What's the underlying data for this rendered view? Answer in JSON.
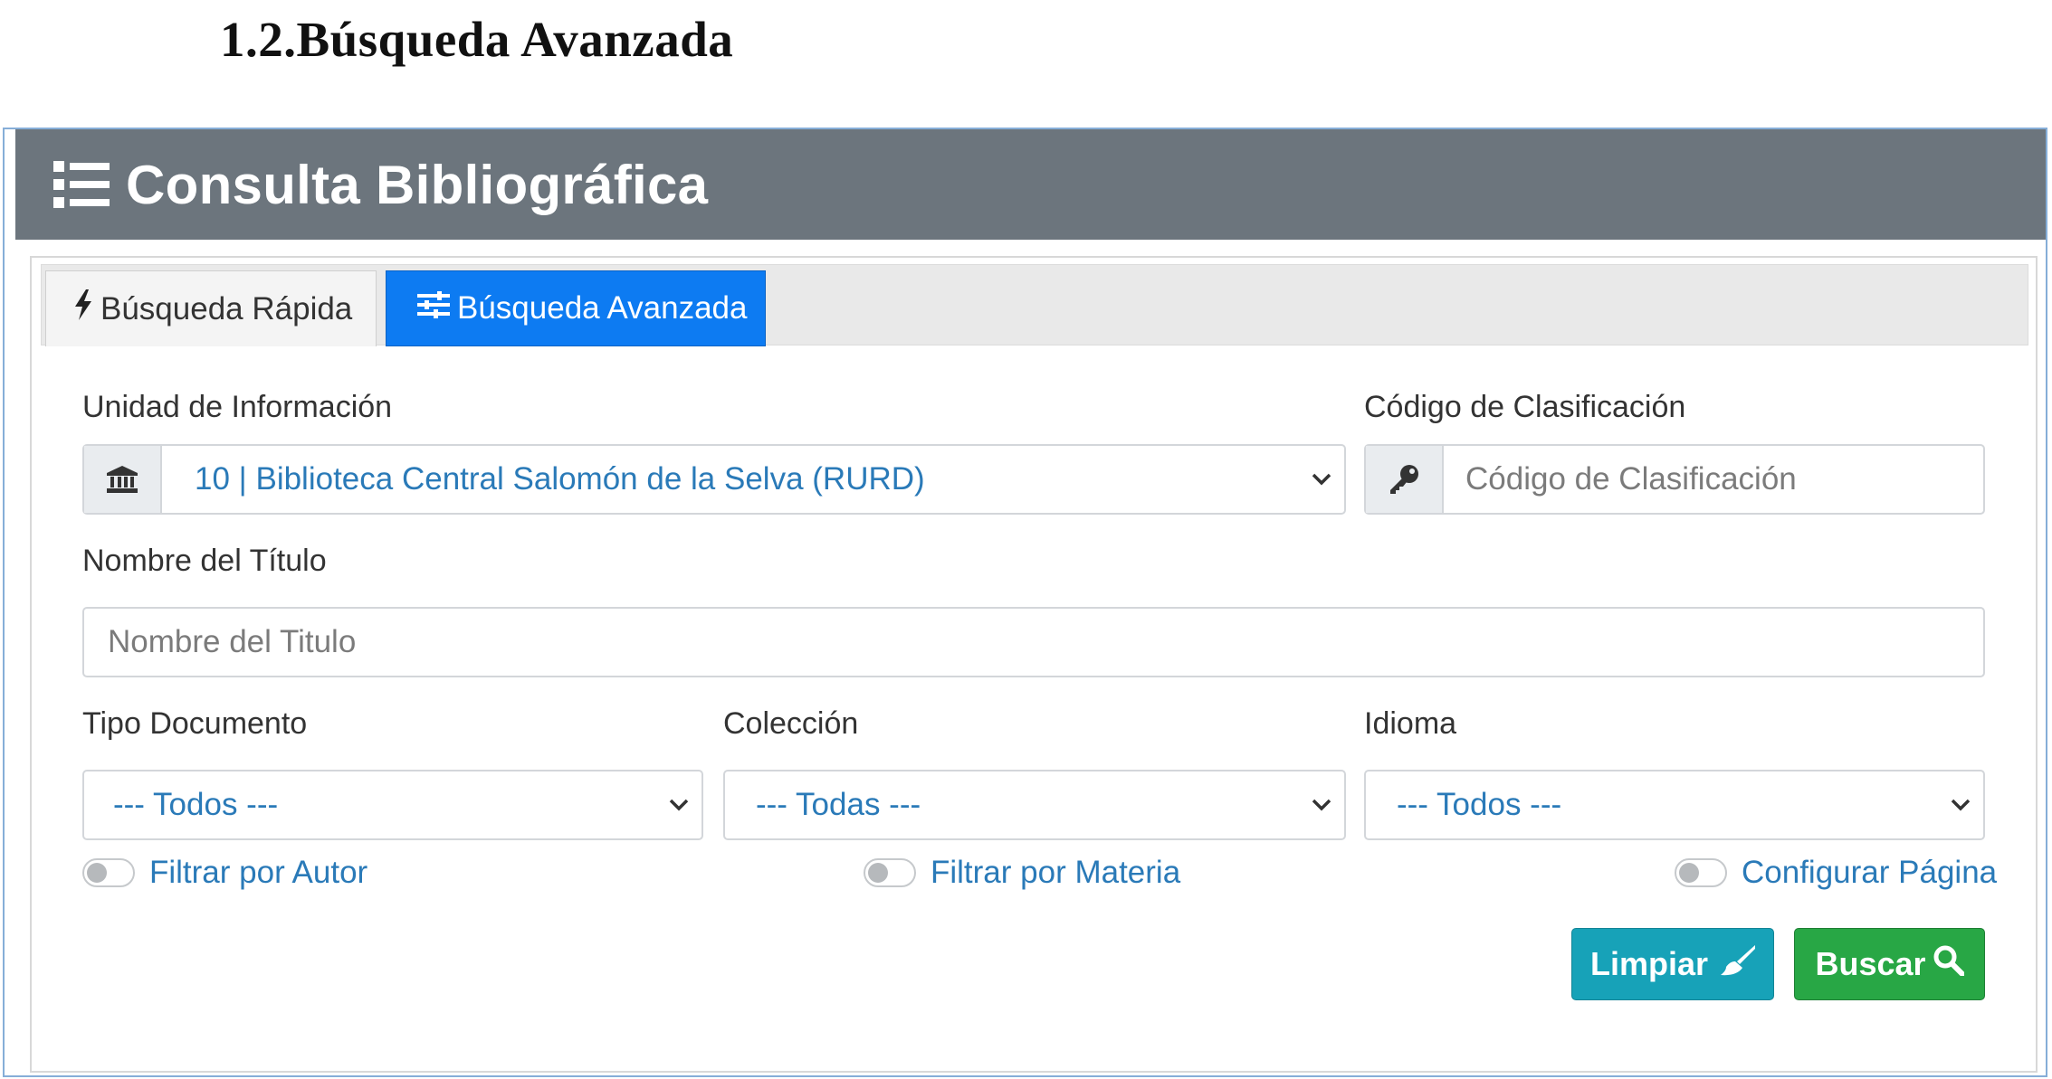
{
  "document": {
    "heading": "1.2.Búsqueda Avanzada"
  },
  "card": {
    "title": "Consulta Bibliográfica",
    "title_icon": "list-icon"
  },
  "tabs": [
    {
      "label": "Búsqueda Rápida",
      "icon": "bolt-icon",
      "active": false
    },
    {
      "label": "Búsqueda Avanzada",
      "icon": "sliders-icon",
      "active": true
    }
  ],
  "form": {
    "unidad": {
      "label": "Unidad de Información",
      "value": "10 | Biblioteca Central Salomón de la Selva (RURD)",
      "icon": "institution-icon"
    },
    "codigo": {
      "label": "Código de Clasificación",
      "placeholder": "Código de Clasificación",
      "icon": "key-icon"
    },
    "titulo": {
      "label": "Nombre del Título",
      "placeholder": "Nombre del Titulo"
    },
    "tipo_documento": {
      "label": "Tipo Documento",
      "value": "--- Todos ---"
    },
    "coleccion": {
      "label": "Colección",
      "value": "--- Todas ---"
    },
    "idioma": {
      "label": "Idioma",
      "value": "--- Todos ---"
    }
  },
  "toggles": [
    {
      "label": "Filtrar por Autor",
      "on": false
    },
    {
      "label": "Filtrar por Materia",
      "on": false
    },
    {
      "label": "Configurar Página",
      "on": false
    }
  ],
  "buttons": {
    "clear": {
      "label": "Limpiar",
      "icon": "broom-icon",
      "color": "#17a2b8"
    },
    "search": {
      "label": "Buscar",
      "icon": "search-icon",
      "color": "#28a745"
    }
  },
  "colors": {
    "header": "#6c757d",
    "active_tab": "#0d7bf2",
    "link_text": "#2a7ab8"
  }
}
